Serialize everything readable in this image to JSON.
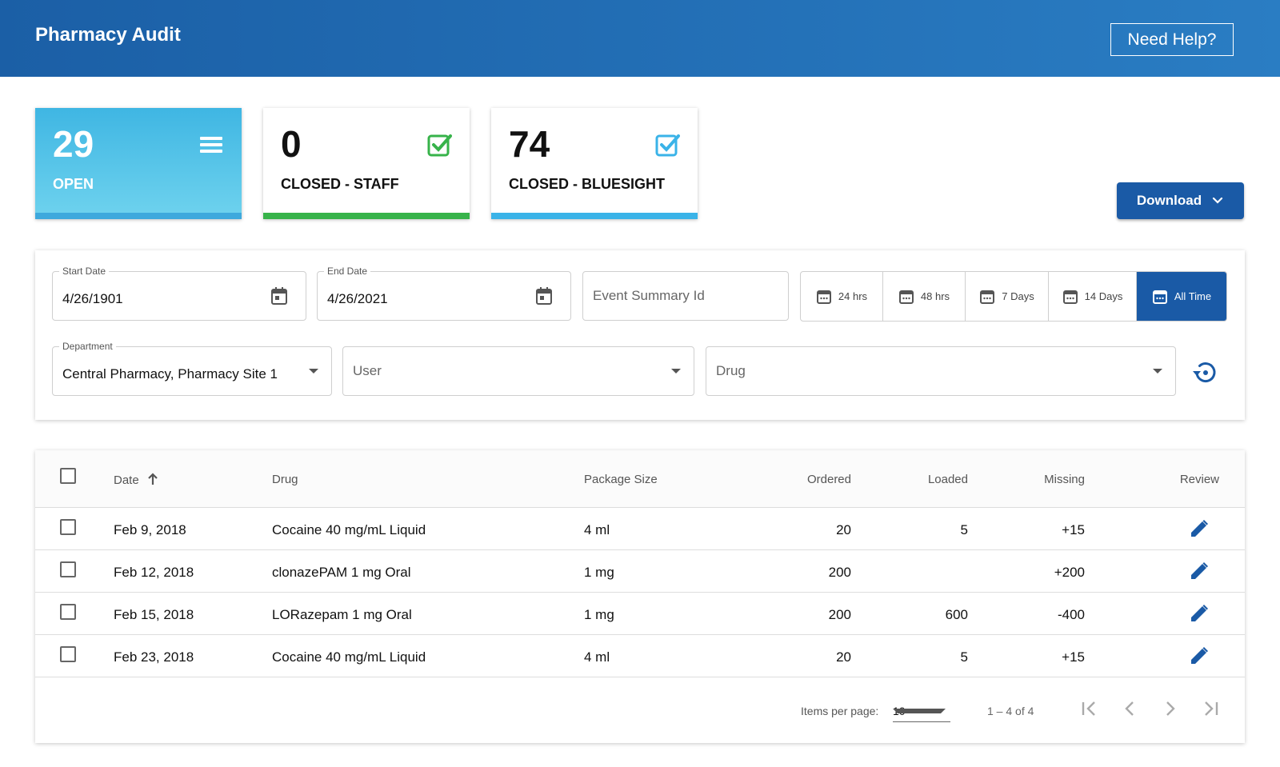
{
  "header": {
    "title": "Pharmacy Audit",
    "help_label": "Need Help?"
  },
  "stats": {
    "open": {
      "value": "29",
      "label": "OPEN",
      "icon": "list-icon",
      "color": "#3fb6e3"
    },
    "closed_staff": {
      "value": "0",
      "label": "CLOSED - STAFF",
      "icon": "check-square-icon",
      "color": "#37b34a"
    },
    "closed_bluesight": {
      "value": "74",
      "label": "CLOSED - BLUESIGHT",
      "icon": "check-square-icon",
      "color": "#3ab3e8"
    }
  },
  "download": {
    "label": "Download",
    "icon": "chevron-down-icon",
    "color": "#1a5aa6"
  },
  "filters": {
    "start_date": {
      "label": "Start Date",
      "value": "4/26/1901",
      "icon": "calendar-icon"
    },
    "end_date": {
      "label": "End Date",
      "value": "4/26/2021",
      "icon": "calendar-icon"
    },
    "event_summary": {
      "placeholder": "Event Summary Id"
    },
    "ranges": [
      {
        "label": "24 hrs",
        "active": false
      },
      {
        "label": "48 hrs",
        "active": false
      },
      {
        "label": "7 Days",
        "active": false
      },
      {
        "label": "14 Days",
        "active": false
      },
      {
        "label": "All Time",
        "active": true
      }
    ],
    "department": {
      "label": "Department",
      "value": "Central Pharmacy, Pharmacy Site 1"
    },
    "user": {
      "placeholder": "User"
    },
    "drug": {
      "placeholder": "Drug"
    },
    "reset_icon": "reset-history-icon"
  },
  "table": {
    "columns": {
      "date": "Date",
      "drug": "Drug",
      "package_size": "Package Size",
      "ordered": "Ordered",
      "loaded": "Loaded",
      "missing": "Missing",
      "review": "Review"
    },
    "sort_icon": "arrow-up-icon",
    "rows": [
      {
        "date": "Feb 9, 2018",
        "drug": "Cocaine 40 mg/mL Liquid",
        "package_size": "4 ml",
        "ordered": "20",
        "loaded": "5",
        "missing": "+15"
      },
      {
        "date": "Feb 12, 2018",
        "drug": "clonazePAM 1 mg Oral",
        "package_size": "1 mg",
        "ordered": "200",
        "loaded": "",
        "missing": "+200"
      },
      {
        "date": "Feb 15, 2018",
        "drug": "LORazepam 1 mg Oral",
        "package_size": "1 mg",
        "ordered": "200",
        "loaded": "600",
        "missing": "-400"
      },
      {
        "date": "Feb 23, 2018",
        "drug": "Cocaine 40 mg/mL Liquid",
        "package_size": "4 ml",
        "ordered": "20",
        "loaded": "5",
        "missing": "+15"
      }
    ]
  },
  "paginator": {
    "items_per_page_label": "Items per page:",
    "items_per_page": "10",
    "range_label": "1 – 4 of 4"
  }
}
